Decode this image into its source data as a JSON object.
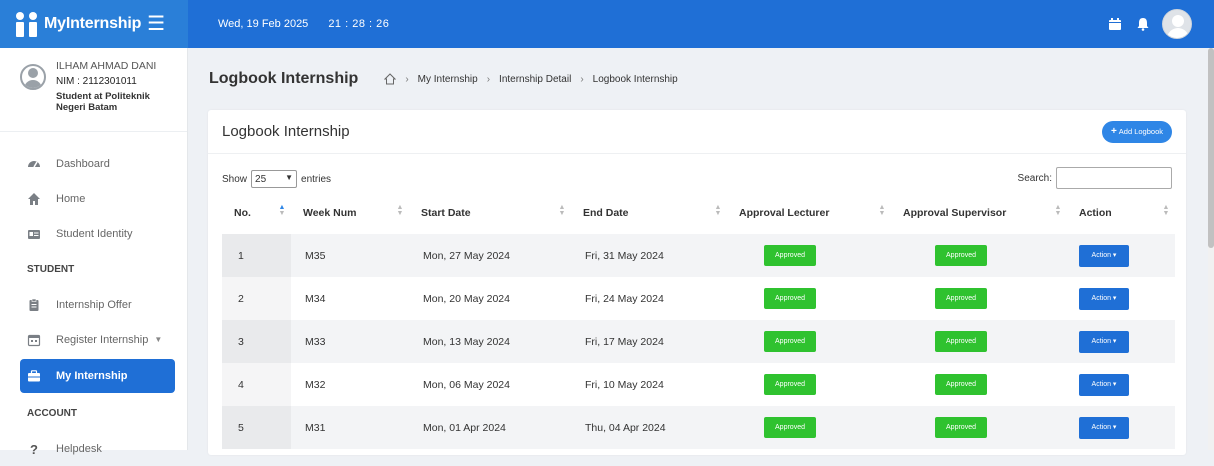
{
  "brand": {
    "name": "MyInternship"
  },
  "topbar": {
    "date": "Wed, 19 Feb 2025",
    "time": "21 : 28 : 26"
  },
  "profile": {
    "name": "ILHAM AHMAD DANI",
    "nim": "NIM : 2112301011",
    "role": "Student at Politeknik Negeri Batam"
  },
  "sidebar": {
    "items": [
      {
        "label": "Dashboard",
        "icon": "dashboard-icon"
      },
      {
        "label": "Home",
        "icon": "home-icon"
      },
      {
        "label": "Student Identity",
        "icon": "id-card-icon"
      }
    ],
    "student_header": "STUDENT",
    "student_items": [
      {
        "label": "Internship Offer",
        "icon": "clipboard-icon"
      },
      {
        "label": "Register Internship",
        "icon": "calendar-icon",
        "caret": "▼"
      },
      {
        "label": "My Internship",
        "icon": "briefcase-icon",
        "active": true
      }
    ],
    "account_header": "ACCOUNT",
    "account_items": [
      {
        "label": "Helpdesk",
        "icon": "question-icon"
      }
    ]
  },
  "page": {
    "title": "Logbook Internship",
    "breadcrumb": [
      "My Internship",
      "Internship Detail",
      "Logbook Internship"
    ]
  },
  "card": {
    "title": "Logbook Internship",
    "add_label": "Add Logbook"
  },
  "table_controls": {
    "show_label": "Show",
    "entries_value": "25",
    "entries_label": "entries",
    "search_label": "Search:",
    "search_value": ""
  },
  "table": {
    "columns": [
      "No.",
      "Week Num",
      "Start Date",
      "End Date",
      "Approval Lecturer",
      "Approval Supervisor",
      "Action"
    ],
    "rows": [
      {
        "no": "1",
        "week": "M35",
        "start": "Mon, 27 May 2024",
        "end": "Fri, 31 May 2024",
        "lecturer": "Approved",
        "supervisor": "Approved",
        "action": "Action ▾"
      },
      {
        "no": "2",
        "week": "M34",
        "start": "Mon, 20 May 2024",
        "end": "Fri, 24 May 2024",
        "lecturer": "Approved",
        "supervisor": "Approved",
        "action": "Action ▾"
      },
      {
        "no": "3",
        "week": "M33",
        "start": "Mon, 13 May 2024",
        "end": "Fri, 17 May 2024",
        "lecturer": "Approved",
        "supervisor": "Approved",
        "action": "Action ▾"
      },
      {
        "no": "4",
        "week": "M32",
        "start": "Mon, 06 May 2024",
        "end": "Fri, 10 May 2024",
        "lecturer": "Approved",
        "supervisor": "Approved",
        "action": "Action ▾"
      },
      {
        "no": "5",
        "week": "M31",
        "start": "Mon, 01 Apr 2024",
        "end": "Thu, 04 Apr 2024",
        "lecturer": "Approved",
        "supervisor": "Approved",
        "action": "Action ▾"
      }
    ]
  },
  "colors": {
    "primary": "#1f6fd6",
    "brand_bg": "#2a7fd8",
    "approved": "#2fc22f",
    "sort_active": "#2f86e6"
  }
}
